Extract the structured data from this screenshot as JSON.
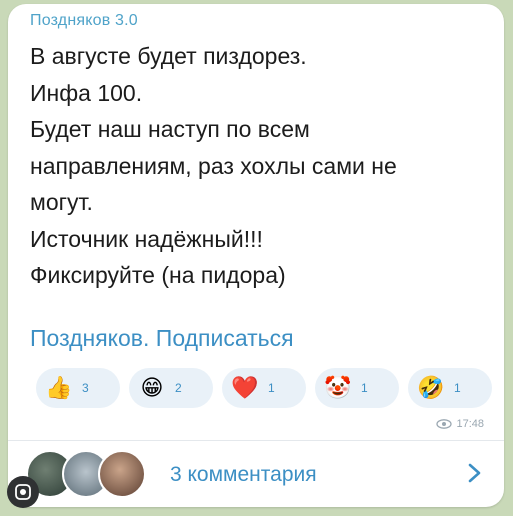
{
  "post": {
    "channel_name": "Поздняков 3.0",
    "lines": [
      "В августе будет пиздорез.",
      "Инфа 100.",
      "Будет наш наступ по всем",
      "направлениям, раз хохлы сами не",
      "могут.",
      "Источник надёжный!!!",
      "Фиксируйте (на пидора)"
    ],
    "signature": "Поздняков. Подписаться",
    "reactions": [
      {
        "emoji": "👍",
        "icon": "thumbs-up-icon",
        "count": "3"
      },
      {
        "emoji": "😁",
        "icon": "grin-icon",
        "count": "2"
      },
      {
        "emoji": "❤️",
        "icon": "heart-icon",
        "count": "1"
      },
      {
        "emoji": "🤡",
        "icon": "clown-icon",
        "count": "1"
      },
      {
        "emoji": "🤣",
        "icon": "rofl-icon",
        "count": "1"
      }
    ],
    "time": "17:48"
  },
  "comments": {
    "label": "3 комментария"
  },
  "colors": {
    "accent": "#3c8fc4",
    "bubble": "#ffffff",
    "background": "#c9d9b8"
  }
}
